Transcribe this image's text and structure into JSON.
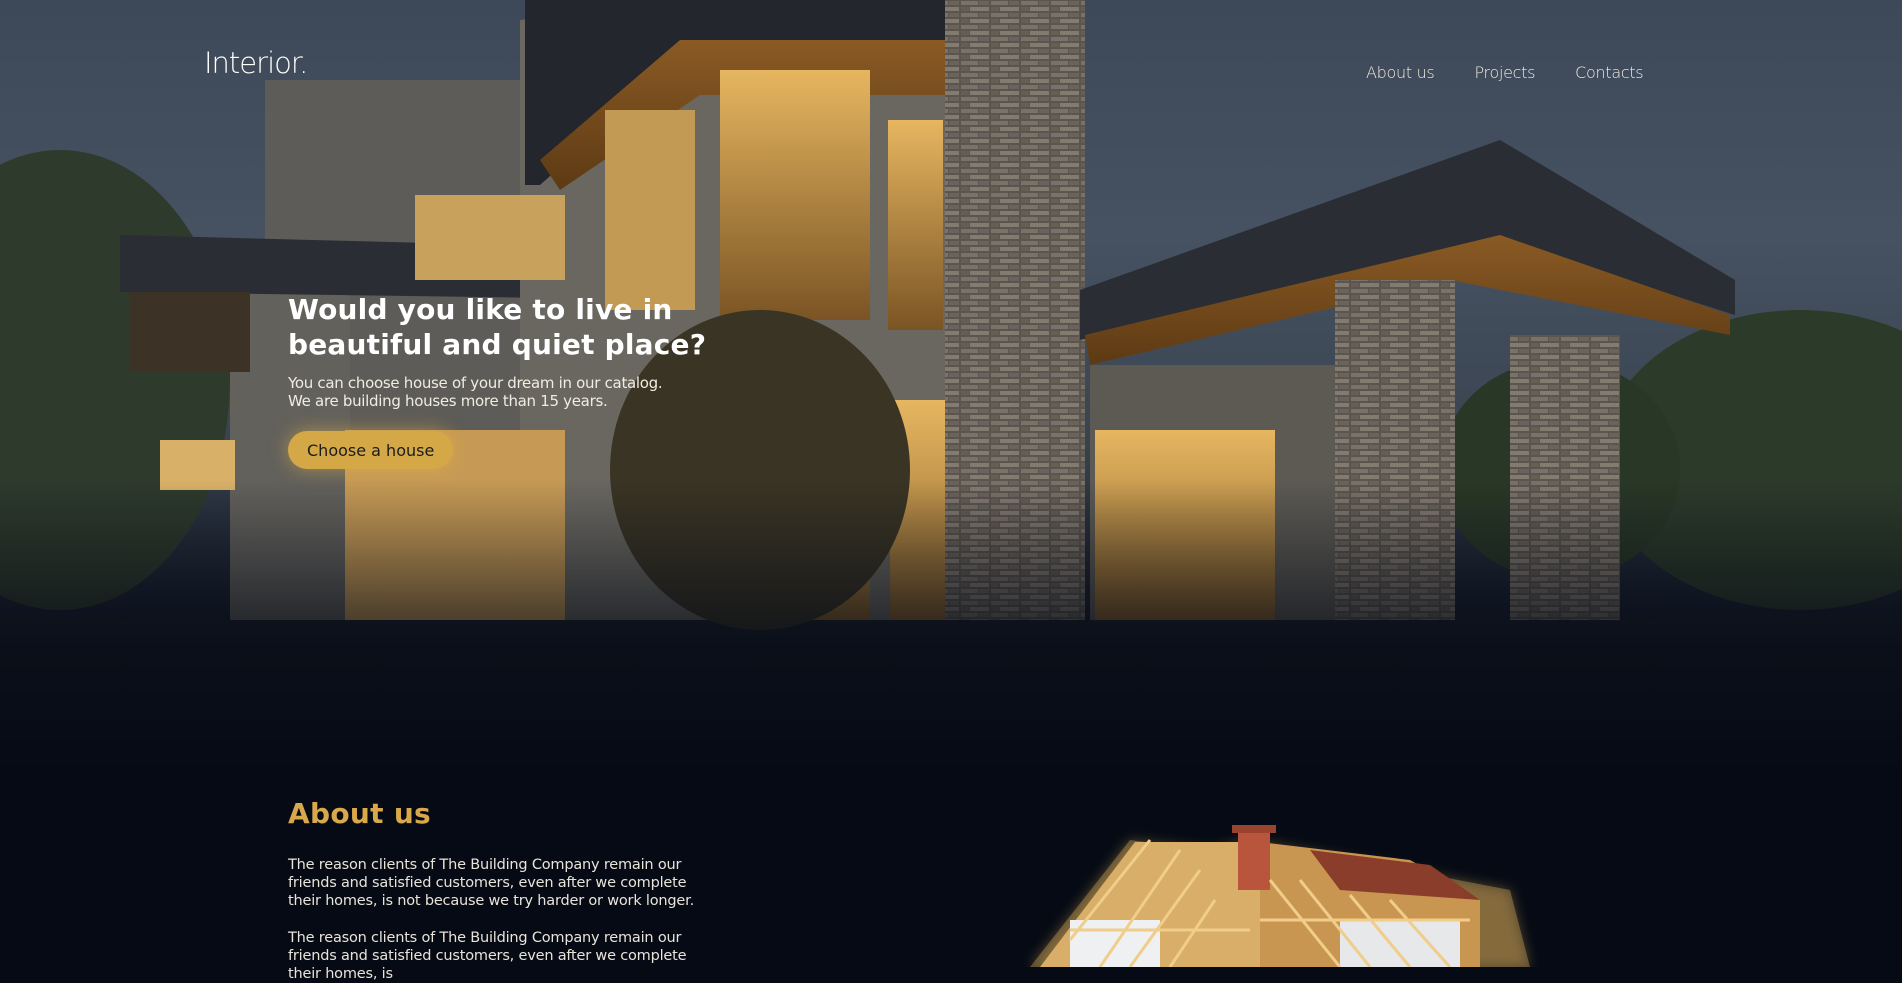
{
  "header": {
    "logo": "Interior.",
    "nav": [
      "About us",
      "Projects",
      "Contacts"
    ]
  },
  "hero": {
    "title": "Would you like to live in beautiful and quiet place?",
    "subtitle_lines": [
      "You can choose house of your dream in our catalog.",
      "We are building houses more than 15 years."
    ],
    "cta_label": "Choose a house"
  },
  "about": {
    "title": "About us",
    "paragraphs": [
      "The reason clients of The Building Company remain our friends and satisfied customers, even after we complete their homes, is not because we try harder or work longer.",
      "The reason clients of The Building Company remain our friends and satisfied customers, even after we complete their homes, is"
    ]
  },
  "colors": {
    "accent": "#d4a846",
    "about_title": "#d8a84a",
    "page_background": "#050a14"
  },
  "icons": [
    "house-photo",
    "house-frame-illustration"
  ]
}
